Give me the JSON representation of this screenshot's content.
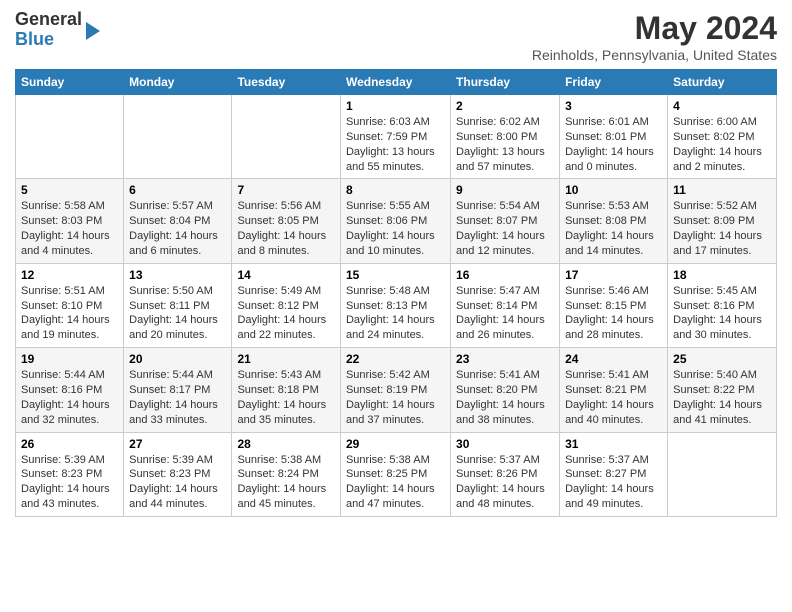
{
  "logo": {
    "general": "General",
    "blue": "Blue"
  },
  "header": {
    "month_year": "May 2024",
    "location": "Reinholds, Pennsylvania, United States"
  },
  "days_of_week": [
    "Sunday",
    "Monday",
    "Tuesday",
    "Wednesday",
    "Thursday",
    "Friday",
    "Saturday"
  ],
  "weeks": [
    [
      {
        "day": "",
        "info": ""
      },
      {
        "day": "",
        "info": ""
      },
      {
        "day": "",
        "info": ""
      },
      {
        "day": "1",
        "sunrise": "Sunrise: 6:03 AM",
        "sunset": "Sunset: 7:59 PM",
        "daylight": "Daylight: 13 hours and 55 minutes."
      },
      {
        "day": "2",
        "sunrise": "Sunrise: 6:02 AM",
        "sunset": "Sunset: 8:00 PM",
        "daylight": "Daylight: 13 hours and 57 minutes."
      },
      {
        "day": "3",
        "sunrise": "Sunrise: 6:01 AM",
        "sunset": "Sunset: 8:01 PM",
        "daylight": "Daylight: 14 hours and 0 minutes."
      },
      {
        "day": "4",
        "sunrise": "Sunrise: 6:00 AM",
        "sunset": "Sunset: 8:02 PM",
        "daylight": "Daylight: 14 hours and 2 minutes."
      }
    ],
    [
      {
        "day": "5",
        "sunrise": "Sunrise: 5:58 AM",
        "sunset": "Sunset: 8:03 PM",
        "daylight": "Daylight: 14 hours and 4 minutes."
      },
      {
        "day": "6",
        "sunrise": "Sunrise: 5:57 AM",
        "sunset": "Sunset: 8:04 PM",
        "daylight": "Daylight: 14 hours and 6 minutes."
      },
      {
        "day": "7",
        "sunrise": "Sunrise: 5:56 AM",
        "sunset": "Sunset: 8:05 PM",
        "daylight": "Daylight: 14 hours and 8 minutes."
      },
      {
        "day": "8",
        "sunrise": "Sunrise: 5:55 AM",
        "sunset": "Sunset: 8:06 PM",
        "daylight": "Daylight: 14 hours and 10 minutes."
      },
      {
        "day": "9",
        "sunrise": "Sunrise: 5:54 AM",
        "sunset": "Sunset: 8:07 PM",
        "daylight": "Daylight: 14 hours and 12 minutes."
      },
      {
        "day": "10",
        "sunrise": "Sunrise: 5:53 AM",
        "sunset": "Sunset: 8:08 PM",
        "daylight": "Daylight: 14 hours and 14 minutes."
      },
      {
        "day": "11",
        "sunrise": "Sunrise: 5:52 AM",
        "sunset": "Sunset: 8:09 PM",
        "daylight": "Daylight: 14 hours and 17 minutes."
      }
    ],
    [
      {
        "day": "12",
        "sunrise": "Sunrise: 5:51 AM",
        "sunset": "Sunset: 8:10 PM",
        "daylight": "Daylight: 14 hours and 19 minutes."
      },
      {
        "day": "13",
        "sunrise": "Sunrise: 5:50 AM",
        "sunset": "Sunset: 8:11 PM",
        "daylight": "Daylight: 14 hours and 20 minutes."
      },
      {
        "day": "14",
        "sunrise": "Sunrise: 5:49 AM",
        "sunset": "Sunset: 8:12 PM",
        "daylight": "Daylight: 14 hours and 22 minutes."
      },
      {
        "day": "15",
        "sunrise": "Sunrise: 5:48 AM",
        "sunset": "Sunset: 8:13 PM",
        "daylight": "Daylight: 14 hours and 24 minutes."
      },
      {
        "day": "16",
        "sunrise": "Sunrise: 5:47 AM",
        "sunset": "Sunset: 8:14 PM",
        "daylight": "Daylight: 14 hours and 26 minutes."
      },
      {
        "day": "17",
        "sunrise": "Sunrise: 5:46 AM",
        "sunset": "Sunset: 8:15 PM",
        "daylight": "Daylight: 14 hours and 28 minutes."
      },
      {
        "day": "18",
        "sunrise": "Sunrise: 5:45 AM",
        "sunset": "Sunset: 8:16 PM",
        "daylight": "Daylight: 14 hours and 30 minutes."
      }
    ],
    [
      {
        "day": "19",
        "sunrise": "Sunrise: 5:44 AM",
        "sunset": "Sunset: 8:16 PM",
        "daylight": "Daylight: 14 hours and 32 minutes."
      },
      {
        "day": "20",
        "sunrise": "Sunrise: 5:44 AM",
        "sunset": "Sunset: 8:17 PM",
        "daylight": "Daylight: 14 hours and 33 minutes."
      },
      {
        "day": "21",
        "sunrise": "Sunrise: 5:43 AM",
        "sunset": "Sunset: 8:18 PM",
        "daylight": "Daylight: 14 hours and 35 minutes."
      },
      {
        "day": "22",
        "sunrise": "Sunrise: 5:42 AM",
        "sunset": "Sunset: 8:19 PM",
        "daylight": "Daylight: 14 hours and 37 minutes."
      },
      {
        "day": "23",
        "sunrise": "Sunrise: 5:41 AM",
        "sunset": "Sunset: 8:20 PM",
        "daylight": "Daylight: 14 hours and 38 minutes."
      },
      {
        "day": "24",
        "sunrise": "Sunrise: 5:41 AM",
        "sunset": "Sunset: 8:21 PM",
        "daylight": "Daylight: 14 hours and 40 minutes."
      },
      {
        "day": "25",
        "sunrise": "Sunrise: 5:40 AM",
        "sunset": "Sunset: 8:22 PM",
        "daylight": "Daylight: 14 hours and 41 minutes."
      }
    ],
    [
      {
        "day": "26",
        "sunrise": "Sunrise: 5:39 AM",
        "sunset": "Sunset: 8:23 PM",
        "daylight": "Daylight: 14 hours and 43 minutes."
      },
      {
        "day": "27",
        "sunrise": "Sunrise: 5:39 AM",
        "sunset": "Sunset: 8:23 PM",
        "daylight": "Daylight: 14 hours and 44 minutes."
      },
      {
        "day": "28",
        "sunrise": "Sunrise: 5:38 AM",
        "sunset": "Sunset: 8:24 PM",
        "daylight": "Daylight: 14 hours and 45 minutes."
      },
      {
        "day": "29",
        "sunrise": "Sunrise: 5:38 AM",
        "sunset": "Sunset: 8:25 PM",
        "daylight": "Daylight: 14 hours and 47 minutes."
      },
      {
        "day": "30",
        "sunrise": "Sunrise: 5:37 AM",
        "sunset": "Sunset: 8:26 PM",
        "daylight": "Daylight: 14 hours and 48 minutes."
      },
      {
        "day": "31",
        "sunrise": "Sunrise: 5:37 AM",
        "sunset": "Sunset: 8:27 PM",
        "daylight": "Daylight: 14 hours and 49 minutes."
      },
      {
        "day": "",
        "info": ""
      }
    ]
  ]
}
